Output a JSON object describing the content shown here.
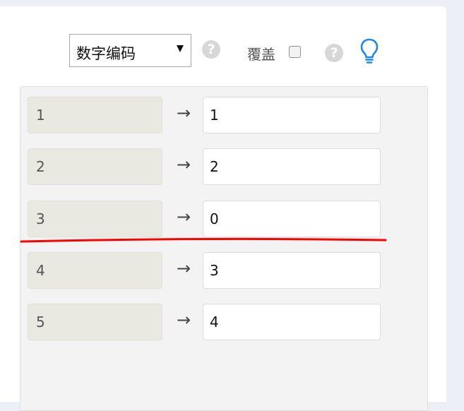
{
  "toolbar": {
    "encoding_select": "数字编码",
    "override_label": "覆盖",
    "help_icon_text": "?"
  },
  "mapping": {
    "rows": [
      {
        "source": "1",
        "arrow": "→",
        "target": "1"
      },
      {
        "source": "2",
        "arrow": "→",
        "target": "2"
      },
      {
        "source": "3",
        "arrow": "→",
        "target": "0"
      },
      {
        "source": "4",
        "arrow": "→",
        "target": "3"
      },
      {
        "source": "5",
        "arrow": "→",
        "target": "4"
      }
    ]
  },
  "colors": {
    "accent": "#1e88e5",
    "annotation_line": "#ff0000",
    "panel_bg": "#f3f3f3",
    "source_bg": "#e9e8e1"
  },
  "icons": {
    "help": "help-icon",
    "bulb": "lightbulb-icon",
    "arrow": "arrow-right-icon"
  }
}
